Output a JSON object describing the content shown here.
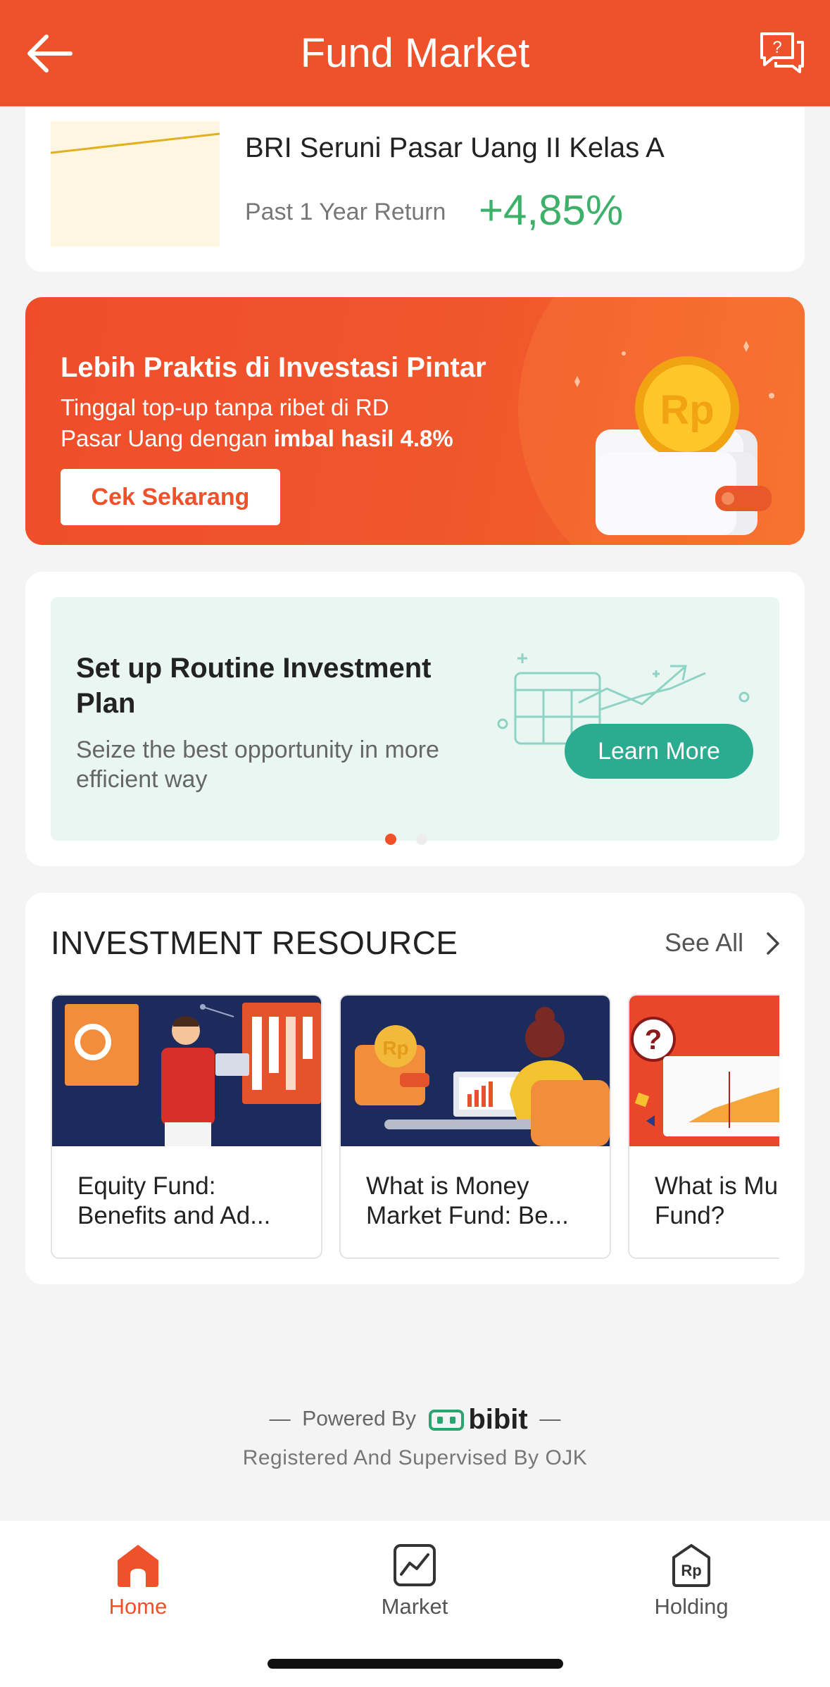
{
  "header": {
    "title": "Fund Market"
  },
  "fund": {
    "name": "BRI Seruni Pasar Uang II Kelas A",
    "return_label": "Past 1 Year Return",
    "return_value": "+4,85%"
  },
  "promo": {
    "title": "Lebih Praktis di Investasi Pintar",
    "line1": "Tinggal top-up tanpa ribet di RD",
    "line2_prefix": "Pasar Uang dengan ",
    "line2_bold": "imbal hasil 4.8%",
    "button": "Cek Sekarang",
    "coin_text": "Rp"
  },
  "plan": {
    "title": "Set up Routine Investment Plan",
    "subtitle": "Seize the best opportunity in more efficient way",
    "button": "Learn More",
    "pager_active": 1,
    "pager_count": 2
  },
  "resources": {
    "title": "INVESTMENT RESOURCE",
    "see_all": "See All",
    "items": [
      {
        "label": "Equity Fund:\nBenefits and Ad..."
      },
      {
        "label": "What is Money\nMarket Fund: Be..."
      },
      {
        "label": "What is Mu\nFund?"
      }
    ]
  },
  "footer": {
    "powered_by": "Powered By",
    "brand": "bibit",
    "registered": "Registered And Supervised By OJK"
  },
  "nav": {
    "items": [
      {
        "label": "Home",
        "active": true
      },
      {
        "label": "Market",
        "active": false
      },
      {
        "label": "Holding",
        "active": false
      }
    ],
    "holding_icon_text": "Rp"
  },
  "colors": {
    "brand": "#ef512b",
    "positive": "#3db06a",
    "teal": "#2bab8f"
  }
}
